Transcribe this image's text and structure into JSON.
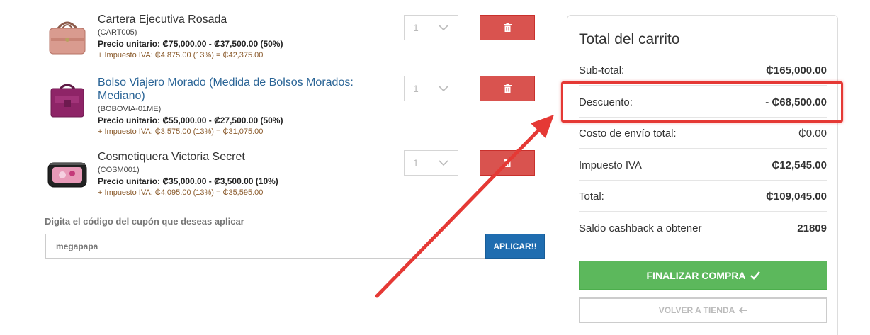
{
  "items": [
    {
      "name": "Cartera Ejecutiva Rosada",
      "sku": "(CART005)",
      "price": "Precio unitario: ₡75,000.00 - ₡37,500.00 (50%)",
      "tax": "+ Impuesto IVA: ₵4,875.00 (13%) = ₵42,375.00",
      "qty": "1"
    },
    {
      "name": "Bolso Viajero Morado (Medida de Bolsos Morados: Mediano)",
      "sku": "(BOBOVIA-01ME)",
      "price": "Precio unitario: ₡55,000.00 - ₡27,500.00 (50%)",
      "tax": "+ Impuesto IVA: ₵3,575.00 (13%) = ₵31,075.00",
      "qty": "1"
    },
    {
      "name": "Cosmetiquera Victoria Secret",
      "sku": "(COSM001)",
      "price": "Precio unitario: ₡35,000.00 - ₡3,500.00 (10%)",
      "tax": "+ Impuesto IVA: ₵4,095.00 (13%) = ₵35,595.00",
      "qty": "1"
    }
  ],
  "coupon": {
    "label": "Digita el código del cupón que deseas aplicar",
    "value": "megapapa",
    "button": "APLICAR!!"
  },
  "cart": {
    "title": "Total del carrito",
    "rows": [
      {
        "label": "Sub-total:",
        "value": "₵165,000.00"
      },
      {
        "label": "Descuento:",
        "value": "- ₵68,500.00"
      },
      {
        "label": "Costo de envío total:",
        "value": "₵0.00"
      },
      {
        "label": "Impuesto IVA",
        "value": "₵12,545.00"
      },
      {
        "label": "Total:",
        "value": "₵109,045.00"
      },
      {
        "label": "Saldo cashback a obtener",
        "value": "21809"
      }
    ],
    "finish_button": "FINALIZAR COMPRA",
    "back_button": "VOLVER A TIENDA"
  },
  "colors": {
    "delete": "#d9534f",
    "apply": "#1f6db0",
    "finish": "#5cb85c",
    "highlight": "#e53935",
    "link": "#2a6496"
  },
  "icons": [
    "trash-icon",
    "chevron-down-icon",
    "check-icon",
    "arrow-left-icon"
  ]
}
